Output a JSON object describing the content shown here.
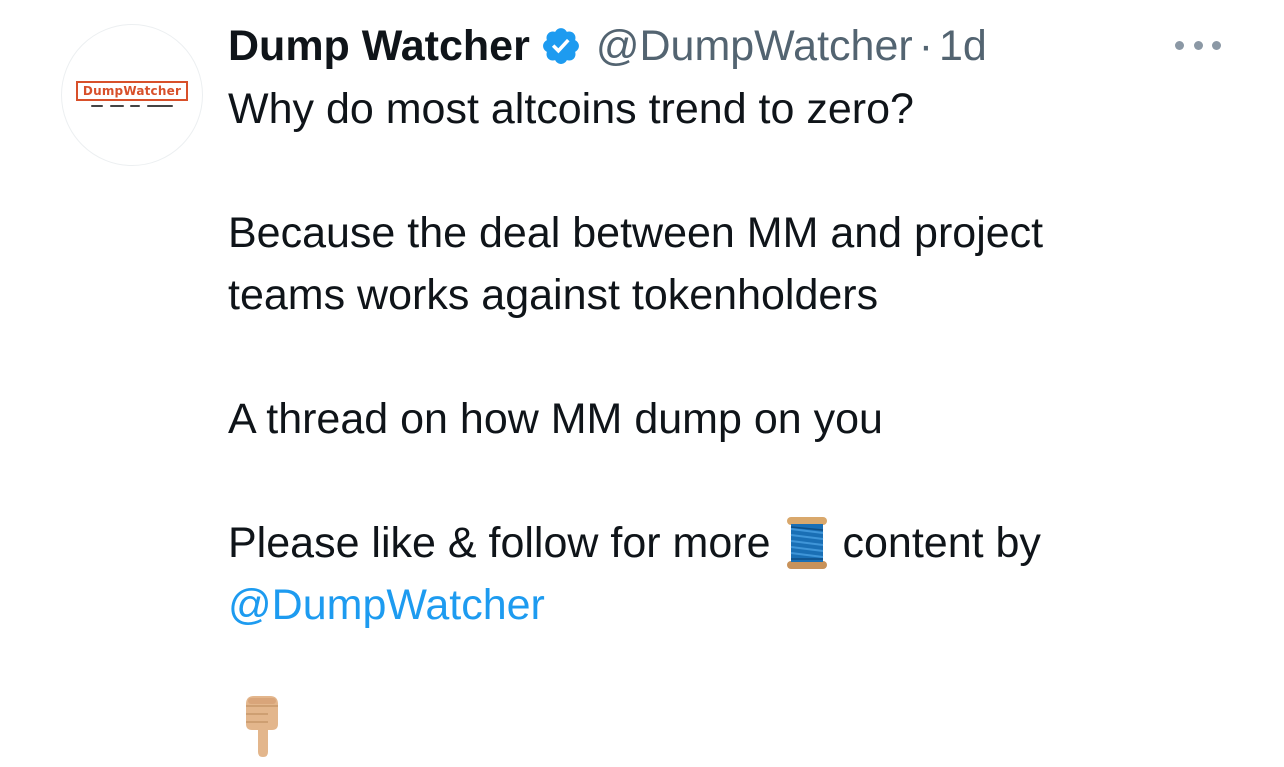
{
  "tweet": {
    "avatar": {
      "logo_text": "DumpWatcher",
      "tagline": "We watch the Dumpers"
    },
    "display_name": "Dump Watcher",
    "verified_icon": "verified-badge-icon",
    "handle": "@DumpWatcher",
    "separator": "·",
    "time": "1d",
    "more_icon": "more-options-icon",
    "body": {
      "line1": "Why do most altcoins trend to zero?",
      "line2": "Because the deal between MM and project",
      "line3": "teams works against tokenholders",
      "line4": "A thread on how MM dump on you",
      "line5_before": "Please like & follow for more",
      "line5_emoji": "thread-spool-emoji",
      "line5_after": "content by",
      "mention": "@DumpWatcher",
      "trailing_emoji": "pointing-down-emoji"
    },
    "colors": {
      "text": "#0f1419",
      "secondary": "#536471",
      "link": "#1d9bf0",
      "verified": "#1d9bf0",
      "logo": "#d8502a"
    }
  }
}
